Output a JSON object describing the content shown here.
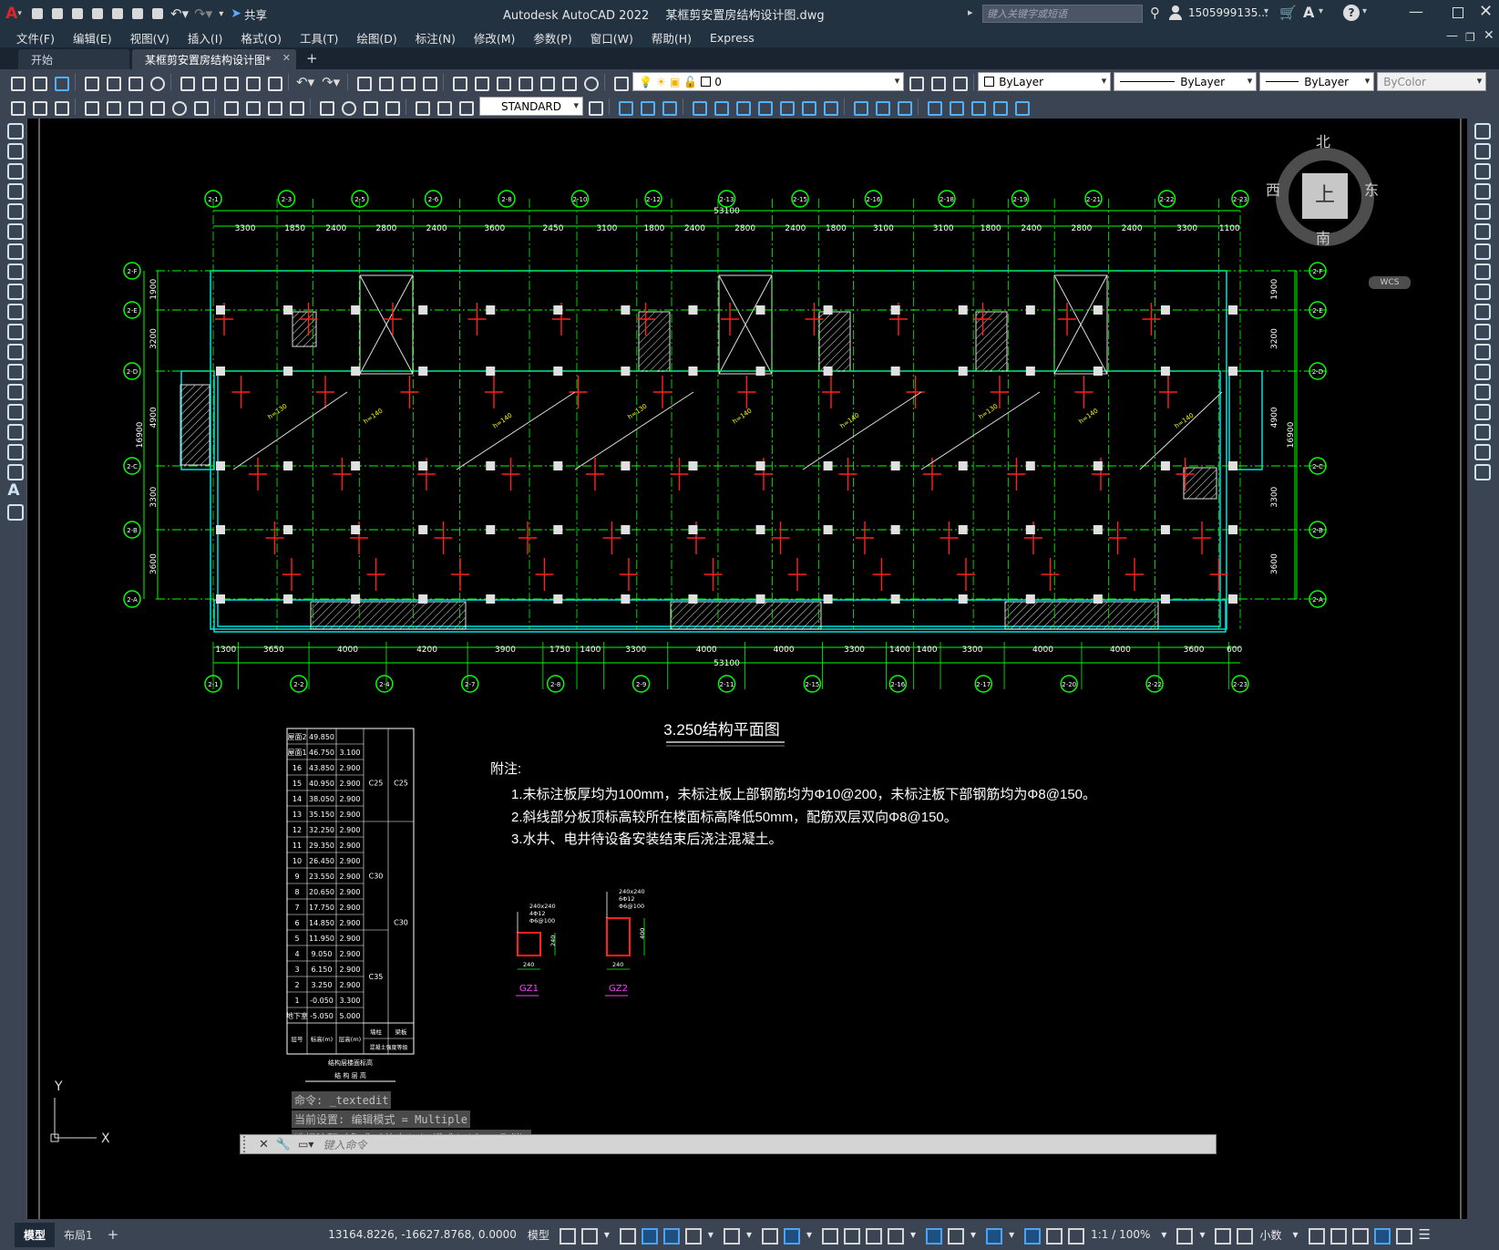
{
  "title_bar": {
    "app_title": "Autodesk AutoCAD 2022",
    "file_name": "某框剪安置房结构设计图.dwg",
    "share_label": "共享",
    "search_placeholder": "键入关键字或短语",
    "user": "1505999135...",
    "help_icon": "question-icon"
  },
  "menu": [
    "文件(F)",
    "编辑(E)",
    "视图(V)",
    "插入(I)",
    "格式(O)",
    "工具(T)",
    "绘图(D)",
    "标注(N)",
    "修改(M)",
    "参数(P)",
    "窗口(W)",
    "帮助(H)",
    "Express"
  ],
  "tabs": {
    "start": "开始",
    "active": "某框剪安置房结构设计图*",
    "add": "+"
  },
  "toolbar": {
    "layer_value": "0",
    "style_value": "STANDARD",
    "color": "ByLayer",
    "linetype": "ByLayer",
    "lineweight": "ByLayer",
    "plotstyle": "ByColor"
  },
  "viewcube": {
    "north": "北",
    "south": "南",
    "east": "东",
    "west": "西",
    "top": "上",
    "wcs": "WCS"
  },
  "drawing": {
    "title": "3.250结构平面图",
    "notes_title": "附注:",
    "notes": [
      "1.未标注板厚均为100mm，未标注板上部钢筋均为Φ10@200，未标注板下部钢筋均为Φ8@150。",
      "2.斜线部分板顶标高较所在楼面标高降低50mm，配筋双层双向Φ8@150。",
      "3.水井、电井待设备安装结束后浇注混凝土。"
    ],
    "overall_dim": "53100",
    "left_total": "16900",
    "right_total": "16900",
    "top_dims": [
      "3300",
      "1850",
      "2400",
      "2800",
      "2400",
      "3600",
      "2450",
      "3100",
      "1800",
      "2400",
      "2800",
      "2400",
      "1800",
      "3100",
      "3100",
      "1800",
      "2400",
      "2800",
      "2400",
      "3300",
      "1100"
    ],
    "bottom_dims": [
      "1300",
      "3650",
      "4000",
      "4200",
      "3900",
      "1750",
      "1400",
      "3300",
      "4000",
      "4000",
      "3300",
      "1400",
      "1400",
      "3300",
      "4000",
      "4000",
      "3600",
      "600"
    ],
    "left_dims": [
      "1900",
      "3200",
      "4900",
      "3300",
      "3600"
    ],
    "right_dims": [
      "1900",
      "3200",
      "4900",
      "3300",
      "3600"
    ],
    "top_axes": [
      "2-1",
      "2-3",
      "2-5",
      "2-6",
      "2-8",
      "2-10",
      "2-12",
      "2-13",
      "2-15",
      "2-16",
      "2-18",
      "2-19",
      "2-21",
      "2-22",
      "2-23"
    ],
    "bottom_axes": [
      "2-1",
      "2-2",
      "2-4",
      "2-7",
      "2-8",
      "2-9",
      "2-11",
      "2-15",
      "2-16",
      "2-17",
      "2-20",
      "2-22",
      "2-23"
    ],
    "row_axes": [
      "2-F",
      "2-E",
      "2-D",
      "2-C",
      "2-B",
      "2-A"
    ],
    "slab_labels": [
      "h=130",
      "h=140",
      "h=140",
      "h=130",
      "h=140",
      "h=140",
      "h=130",
      "h=140",
      "h=140"
    ],
    "floor_table": {
      "rows": [
        [
          "屋面2",
          "49.850",
          ""
        ],
        [
          "屋面1",
          "46.750",
          "3.100"
        ],
        [
          "16",
          "43.850",
          "2.900"
        ],
        [
          "15",
          "40.950",
          "2.900"
        ],
        [
          "14",
          "38.050",
          "2.900"
        ],
        [
          "13",
          "35.150",
          "2.900"
        ],
        [
          "12",
          "32.250",
          "2.900"
        ],
        [
          "11",
          "29.350",
          "2.900"
        ],
        [
          "10",
          "26.450",
          "2.900"
        ],
        [
          "9",
          "23.550",
          "2.900"
        ],
        [
          "8",
          "20.650",
          "2.900"
        ],
        [
          "7",
          "17.750",
          "2.900"
        ],
        [
          "6",
          "14.850",
          "2.900"
        ],
        [
          "5",
          "11.950",
          "2.900"
        ],
        [
          "4",
          "9.050",
          "2.900"
        ],
        [
          "3",
          "6.150",
          "2.900"
        ],
        [
          "2",
          "3.250",
          "2.900"
        ],
        [
          "1",
          "-0.050",
          "3.300"
        ],
        [
          "地下室",
          "-5.050",
          "5.000"
        ]
      ],
      "grade_cols": [
        [
          "C25",
          "C30",
          "C35"
        ],
        [
          "C25",
          "C30"
        ]
      ],
      "footer": [
        "层号",
        "标高(m)",
        "层高(m)",
        "墙柱",
        "梁板"
      ],
      "footer2": "混凝土强度等级",
      "caption": "结构层楼面标高",
      "caption2": "结 构 层 高"
    },
    "gz1": {
      "label": "GZ1",
      "spec": [
        "240x240",
        "4Φ12",
        "Φ6@100"
      ],
      "dim_w": "240",
      "dim_h": "240"
    },
    "gz2": {
      "label": "GZ2",
      "spec": [
        "240x240",
        "6Φ12",
        "Φ6@100"
      ],
      "dim_w": "240",
      "dim_h": "400"
    },
    "ucs": {
      "x": "X",
      "y": "Y"
    }
  },
  "command": {
    "history": [
      "命令: _textedit",
      "当前设置: 编辑模式 = Multiple",
      "选择注释对象或 [放弃(U)/模式(M)]: *取消*"
    ],
    "placeholder": "键入命令"
  },
  "status": {
    "model_tab": "模型",
    "layout_tab": "布局1",
    "add_tab": "+",
    "coords": "13164.8226, -16627.8768, 0.0000",
    "space": "模型",
    "scale": "1:1 / 100%",
    "units": "小数"
  },
  "colors": {
    "accent": "#0078d7",
    "grid": "#00ff00",
    "rebar": "#ff2020",
    "wall": "#00ffff"
  }
}
